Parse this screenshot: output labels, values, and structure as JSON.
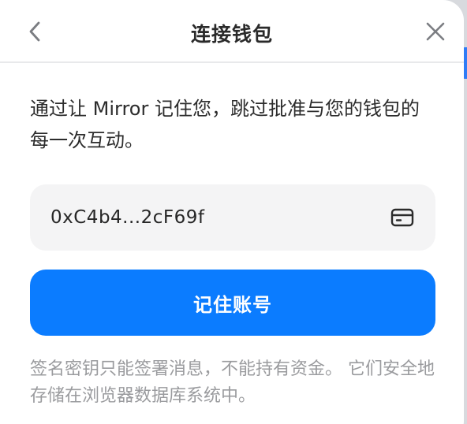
{
  "dialog": {
    "title": "连接钱包",
    "back_icon": "chevron-left-icon",
    "close_icon": "close-icon"
  },
  "content": {
    "description": "通过让 Mirror 记住您，跳过批准与您的钱包的每一次互动。",
    "wallet_address": "0xC4b4...2cF69f",
    "wallet_icon": "wallet-card-icon",
    "remember_button_label": "记住账号",
    "footnote": "签名密钥只能签署消息，不能持有资金。 它们安全地存储在浏览器数据库系统中。"
  },
  "colors": {
    "accent": "#0b7cff",
    "text_primary": "#2c2c2c",
    "text_muted": "#9a9b9e",
    "address_bg": "#f4f4f5"
  }
}
